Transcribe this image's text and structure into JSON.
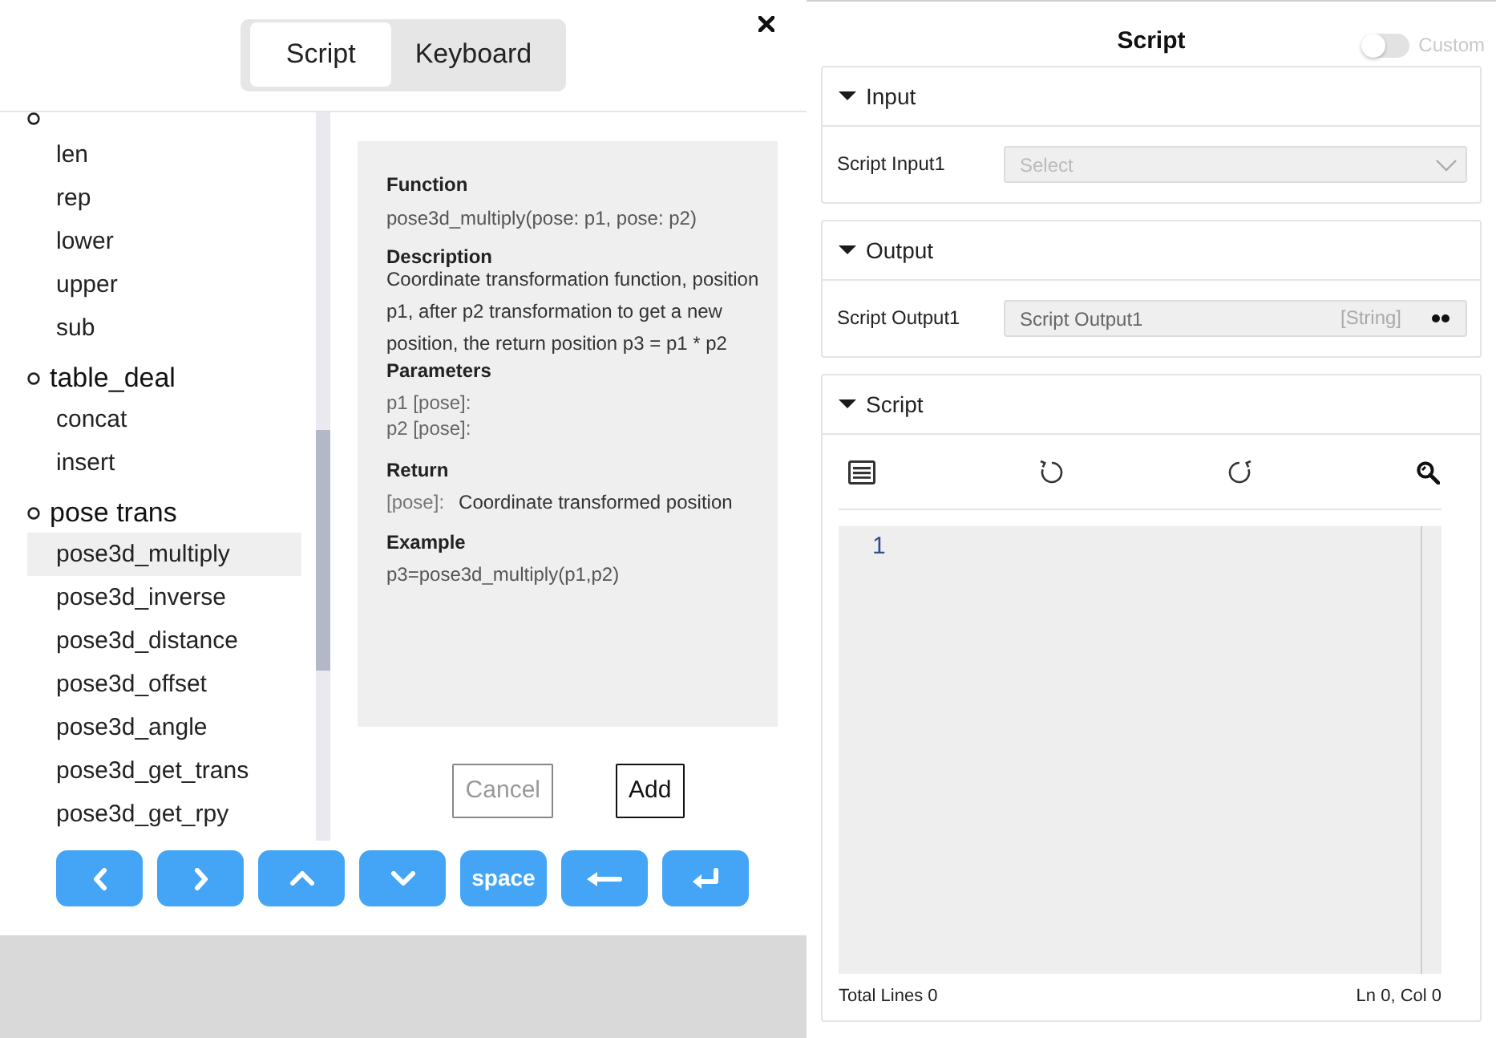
{
  "dialog": {
    "tabs": [
      {
        "label": "Script",
        "selected": true
      },
      {
        "label": "Keyboard",
        "selected": false
      }
    ],
    "tree": [
      {
        "children": [
          {
            "label": "len",
            "selected": false
          },
          {
            "label": "rep",
            "selected": false
          },
          {
            "label": "lower",
            "selected": false
          },
          {
            "label": "upper",
            "selected": false
          },
          {
            "label": "sub",
            "selected": false
          }
        ]
      },
      {
        "label": "table_deal",
        "children": [
          {
            "label": "concat",
            "selected": false
          },
          {
            "label": "insert",
            "selected": false
          }
        ]
      },
      {
        "label": "pose trans",
        "children": [
          {
            "label": "pose3d_multiply",
            "selected": true
          },
          {
            "label": "pose3d_inverse",
            "selected": false
          },
          {
            "label": "pose3d_distance",
            "selected": false
          },
          {
            "label": "pose3d_offset",
            "selected": false
          },
          {
            "label": "pose3d_angle",
            "selected": false
          },
          {
            "label": "pose3d_get_trans",
            "selected": false
          },
          {
            "label": "pose3d_get_rpy",
            "selected": false
          }
        ]
      }
    ],
    "doc": {
      "function_heading": "Function",
      "signature": "pose3d_multiply(pose: p1, pose: p2)",
      "description_heading": "Description",
      "description": "Coordinate transformation function, position p1, after p2 transformation to get a new position, the return position p3 = p1 * p2",
      "parameters_heading": "Parameters",
      "parameters": [
        "p1 [pose]:",
        "p2 [pose]:"
      ],
      "return_heading": "Return",
      "return_type": "[pose]:",
      "return_text": "Coordinate transformed position",
      "example_heading": "Example",
      "example": "p3=pose3d_multiply(p1,p2)"
    },
    "buttons": [
      {
        "label": "Cancel",
        "disabled": true
      },
      {
        "label": "Add",
        "disabled": false
      }
    ],
    "keys": [
      {
        "kind": "left"
      },
      {
        "kind": "right"
      },
      {
        "kind": "up"
      },
      {
        "kind": "down"
      },
      {
        "kind": "text",
        "label": "space"
      },
      {
        "kind": "backspace"
      },
      {
        "kind": "enter"
      }
    ]
  },
  "panel": {
    "title": "Script",
    "custom_toggle": {
      "label": "Custom",
      "on": false
    },
    "sections": [
      {
        "kind": "input",
        "title": "Input",
        "expanded": true,
        "rows": [
          {
            "label": "Script Input1",
            "placeholder": "Select"
          }
        ]
      },
      {
        "kind": "output",
        "title": "Output",
        "expanded": true,
        "rows": [
          {
            "label": "Script Output1",
            "value": "Script Output1",
            "type": "[String]"
          }
        ]
      },
      {
        "kind": "editor",
        "title": "Script",
        "expanded": true,
        "line_numbers": [
          "1"
        ],
        "total_lines": "Total Lines 0",
        "cursor": "Ln 0, Col 0"
      }
    ]
  }
}
